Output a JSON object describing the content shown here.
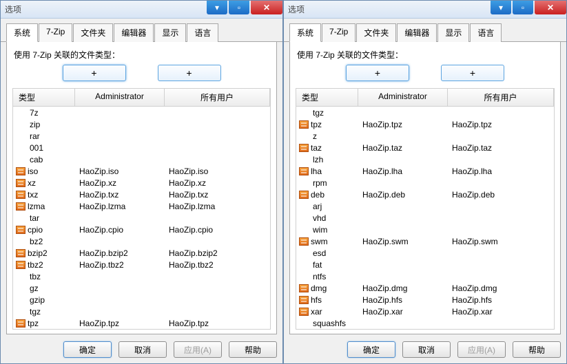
{
  "window_title": "选项",
  "tabs": [
    "系统",
    "7-Zip",
    "文件夹",
    "编辑器",
    "显示",
    "语言"
  ],
  "active_tab_index": 0,
  "associate_label": "使用 7-Zip 关联的文件类型：",
  "plus_label": "+",
  "columns": {
    "type": "类型",
    "admin": "Administrator",
    "all": "所有用户"
  },
  "buttons": {
    "ok": "确定",
    "cancel": "取消",
    "apply": "应用(A)",
    "help": "帮助"
  },
  "left_rows": [
    {
      "icon": false,
      "type": "7z",
      "admin": "",
      "all": ""
    },
    {
      "icon": false,
      "type": "zip",
      "admin": "",
      "all": ""
    },
    {
      "icon": false,
      "type": "rar",
      "admin": "",
      "all": ""
    },
    {
      "icon": false,
      "type": "001",
      "admin": "",
      "all": ""
    },
    {
      "icon": false,
      "type": "cab",
      "admin": "",
      "all": ""
    },
    {
      "icon": true,
      "type": "iso",
      "admin": "HaoZip.iso",
      "all": "HaoZip.iso"
    },
    {
      "icon": true,
      "type": "xz",
      "admin": "HaoZip.xz",
      "all": "HaoZip.xz"
    },
    {
      "icon": true,
      "type": "txz",
      "admin": "HaoZip.txz",
      "all": "HaoZip.txz"
    },
    {
      "icon": true,
      "type": "lzma",
      "admin": "HaoZip.lzma",
      "all": "HaoZip.lzma"
    },
    {
      "icon": false,
      "type": "tar",
      "admin": "",
      "all": ""
    },
    {
      "icon": true,
      "type": "cpio",
      "admin": "HaoZip.cpio",
      "all": "HaoZip.cpio"
    },
    {
      "icon": false,
      "type": "bz2",
      "admin": "",
      "all": ""
    },
    {
      "icon": true,
      "type": "bzip2",
      "admin": "HaoZip.bzip2",
      "all": "HaoZip.bzip2"
    },
    {
      "icon": true,
      "type": "tbz2",
      "admin": "HaoZip.tbz2",
      "all": "HaoZip.tbz2"
    },
    {
      "icon": false,
      "type": "tbz",
      "admin": "",
      "all": ""
    },
    {
      "icon": false,
      "type": "gz",
      "admin": "",
      "all": ""
    },
    {
      "icon": false,
      "type": "gzip",
      "admin": "",
      "all": ""
    },
    {
      "icon": false,
      "type": "tgz",
      "admin": "",
      "all": ""
    },
    {
      "icon": true,
      "type": "tpz",
      "admin": "HaoZip.tpz",
      "all": "HaoZip.tpz"
    }
  ],
  "right_rows": [
    {
      "icon": false,
      "type": "tgz",
      "admin": "",
      "all": ""
    },
    {
      "icon": true,
      "type": "tpz",
      "admin": "HaoZip.tpz",
      "all": "HaoZip.tpz"
    },
    {
      "icon": false,
      "type": "z",
      "admin": "",
      "all": ""
    },
    {
      "icon": true,
      "type": "taz",
      "admin": "HaoZip.taz",
      "all": "HaoZip.taz"
    },
    {
      "icon": false,
      "type": "lzh",
      "admin": "",
      "all": ""
    },
    {
      "icon": true,
      "type": "lha",
      "admin": "HaoZip.lha",
      "all": "HaoZip.lha"
    },
    {
      "icon": false,
      "type": "rpm",
      "admin": "",
      "all": ""
    },
    {
      "icon": true,
      "type": "deb",
      "admin": "HaoZip.deb",
      "all": "HaoZip.deb"
    },
    {
      "icon": false,
      "type": "arj",
      "admin": "",
      "all": ""
    },
    {
      "icon": false,
      "type": "vhd",
      "admin": "",
      "all": ""
    },
    {
      "icon": false,
      "type": "wim",
      "admin": "",
      "all": ""
    },
    {
      "icon": true,
      "type": "swm",
      "admin": "HaoZip.swm",
      "all": "HaoZip.swm"
    },
    {
      "icon": false,
      "type": "esd",
      "admin": "",
      "all": ""
    },
    {
      "icon": false,
      "type": "fat",
      "admin": "",
      "all": ""
    },
    {
      "icon": false,
      "type": "ntfs",
      "admin": "",
      "all": ""
    },
    {
      "icon": true,
      "type": "dmg",
      "admin": "HaoZip.dmg",
      "all": "HaoZip.dmg"
    },
    {
      "icon": true,
      "type": "hfs",
      "admin": "HaoZip.hfs",
      "all": "HaoZip.hfs"
    },
    {
      "icon": true,
      "type": "xar",
      "admin": "HaoZip.xar",
      "all": "HaoZip.xar"
    },
    {
      "icon": false,
      "type": "squashfs",
      "admin": "",
      "all": ""
    }
  ]
}
